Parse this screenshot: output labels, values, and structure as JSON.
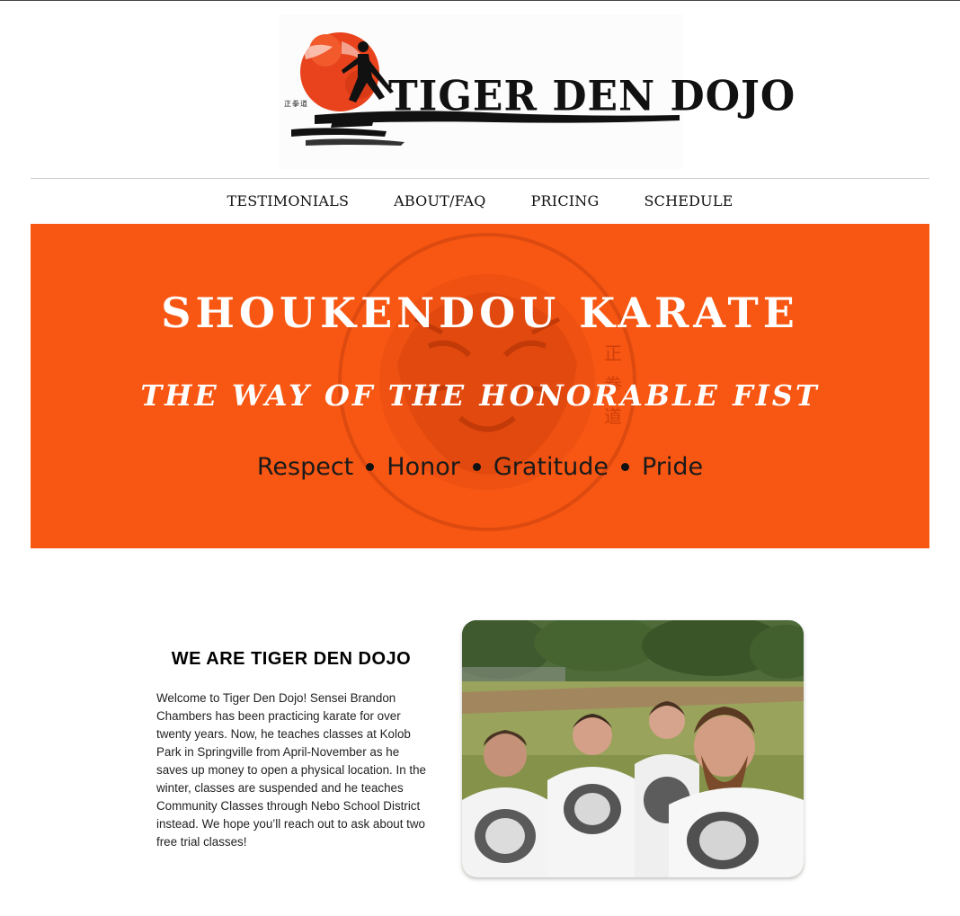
{
  "logo": {
    "text": "TIGER DEN DOJO",
    "kanji": "正拳道"
  },
  "nav": {
    "items": [
      {
        "label": "TESTIMONIALS"
      },
      {
        "label": "ABOUT/FAQ"
      },
      {
        "label": "PRICING"
      },
      {
        "label": "SCHEDULE"
      }
    ]
  },
  "hero": {
    "title": "SHOUKENDOU KARATE",
    "subtitle": "THE WAY OF THE HONORABLE FIST",
    "values": [
      "Respect",
      "Honor",
      "Gratitude",
      "Pride"
    ],
    "emblem_kanji": "正拳道",
    "background_color": "#f75712"
  },
  "about": {
    "title": "WE ARE TIGER DEN DOJO",
    "body": "Welcome to Tiger Den Dojo! Sensei Brandon Chambers has been practicing karate for over twenty years. Now, he teaches classes at Kolob Park in Springville from April-November as he saves up money to open a physical location. In the winter, classes are suspended and he teaches Community Classes through Nebo School District instead. We hope you’ll reach out to ask about two free trial classes!"
  },
  "colors": {
    "accent": "#f75712",
    "text": "#111111"
  }
}
